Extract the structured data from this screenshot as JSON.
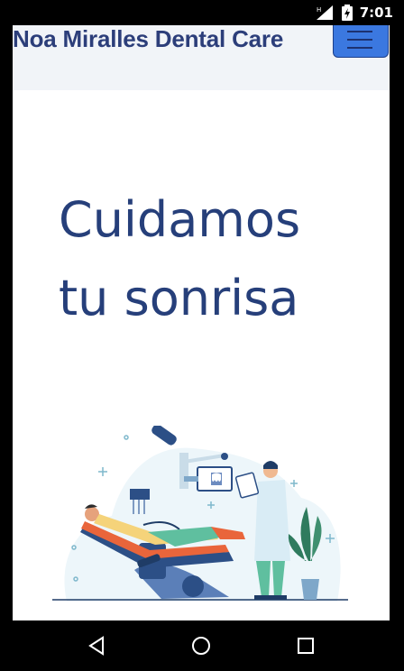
{
  "status_bar": {
    "time": "7:01",
    "icons": [
      "signal-icon",
      "battery-icon"
    ]
  },
  "navbar": {
    "brand": "Noa Miralles Dental Care",
    "menu_icon": "hamburger-icon"
  },
  "hero": {
    "title_line1": "Cuidamos",
    "title_line2": "tu sonrisa"
  },
  "illustration": {
    "subject": "dentist-illustration"
  },
  "system_nav": {
    "back": "back-icon",
    "home": "home-icon",
    "recents": "recents-icon"
  },
  "colors": {
    "brand": "#2c3e7a",
    "title": "#263f7a",
    "menu_button": "#3b78e0",
    "navbar_bg": "#f1f4f8"
  }
}
